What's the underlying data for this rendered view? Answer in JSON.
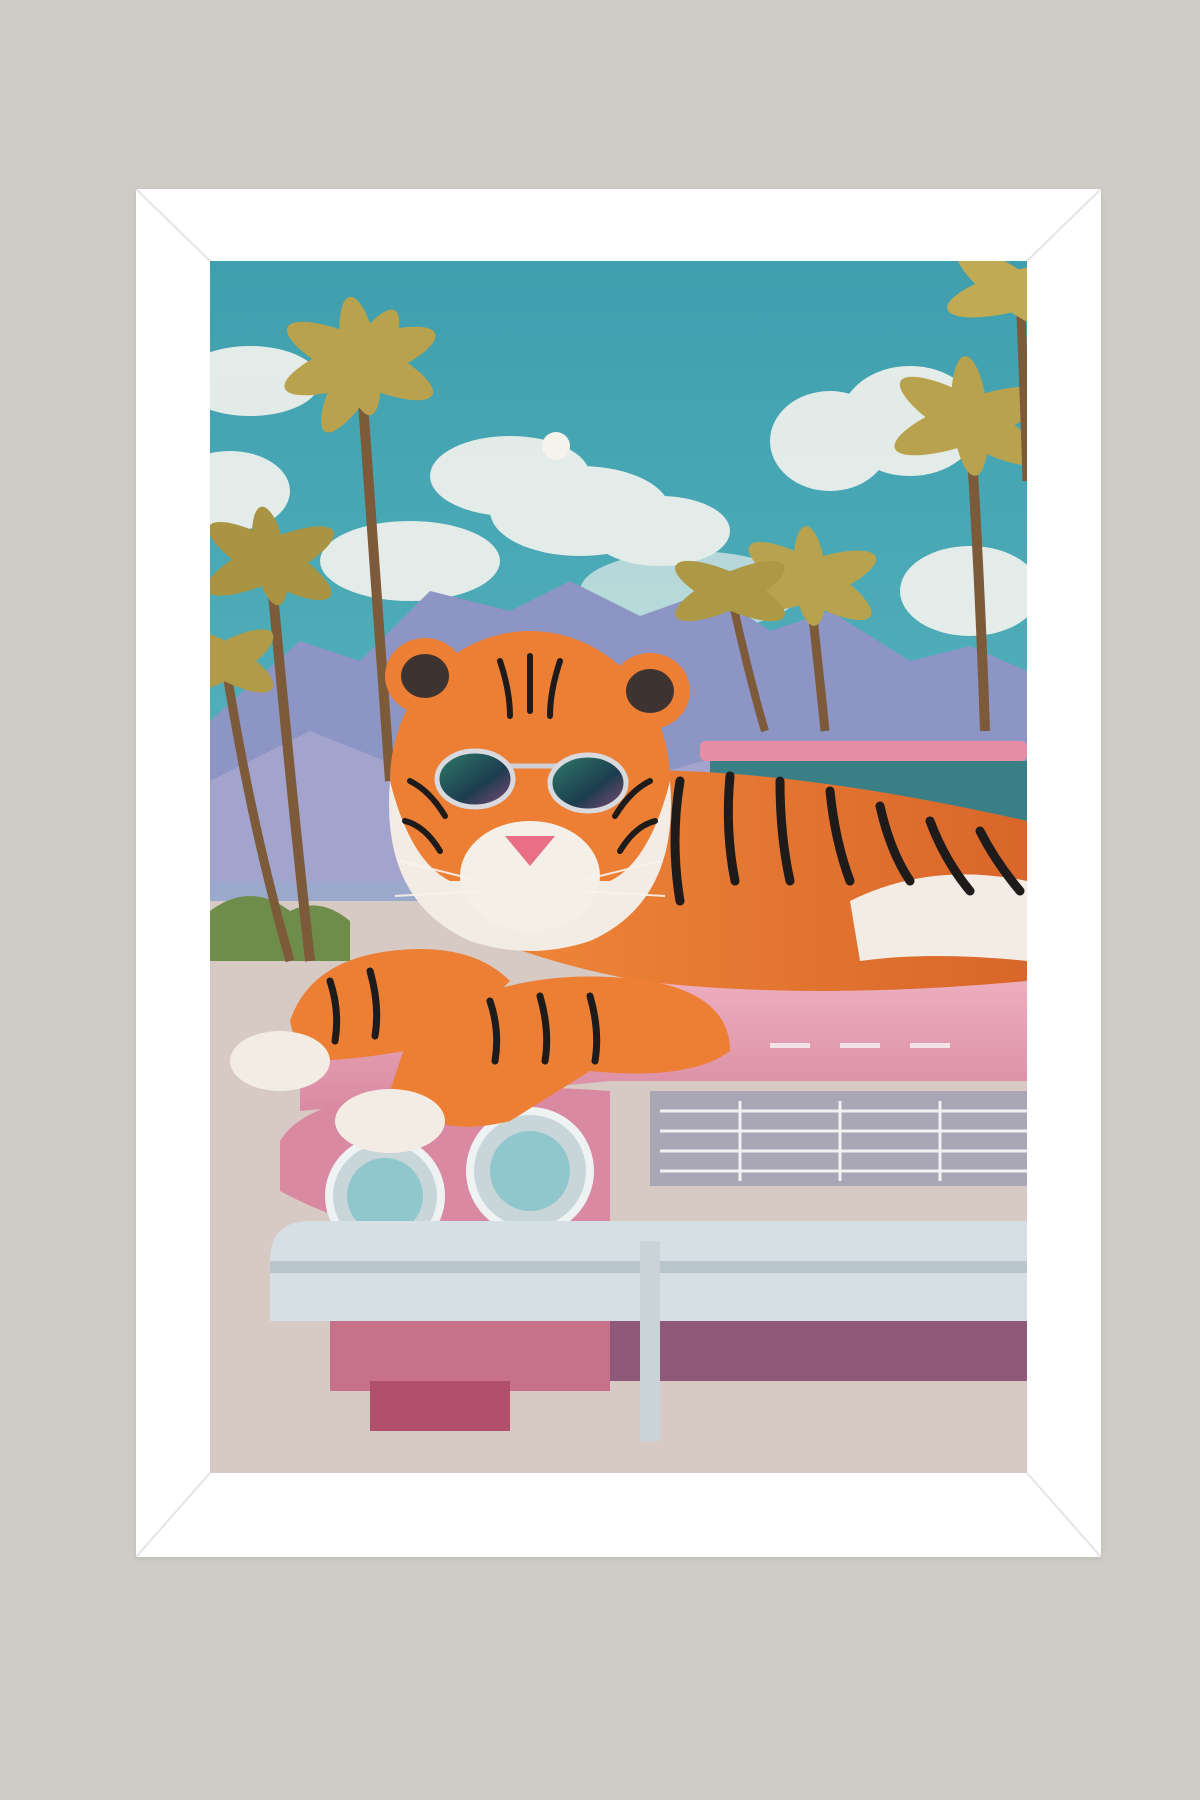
{
  "artwork": {
    "subject": "tiger-with-sunglasses-on-pink-car",
    "colors": {
      "wall": "#cfcbc6",
      "frame": "#ffffff",
      "sky": "#4aa9b4",
      "cloud": "#f1f2ee",
      "mountain": "#8d95c4",
      "palm_leaf": "#b9a24d",
      "tiger_orange": "#e9782c",
      "car_pink": "#e7a0b2",
      "chrome": "#d6dfe3"
    }
  }
}
